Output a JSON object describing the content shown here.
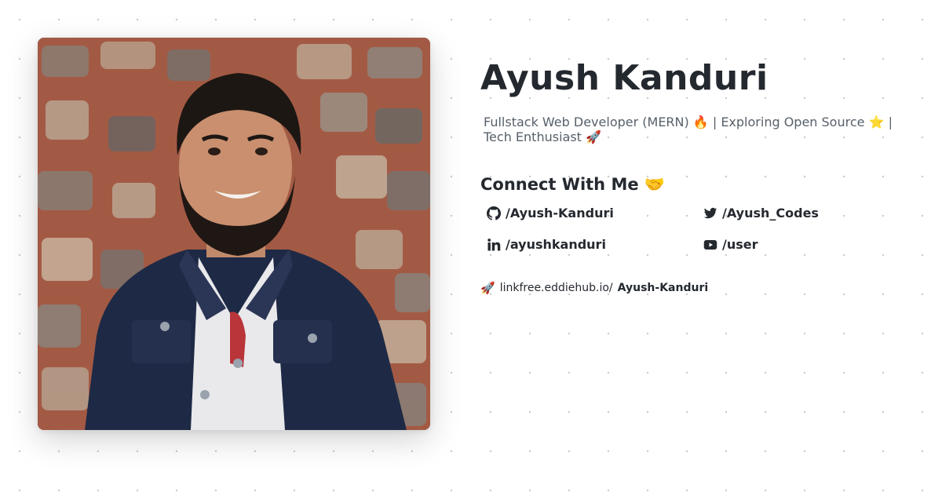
{
  "profile": {
    "name": "Ayush Kanduri",
    "tagline": "Fullstack Web Developer (MERN) 🔥 | Exploring Open Source ⭐ | Tech Enthusiast 🚀",
    "photo_alt": "profile photo"
  },
  "connect": {
    "heading": "Connect With Me 🤝",
    "links": [
      {
        "icon": "github-icon",
        "label": "/Ayush-Kanduri"
      },
      {
        "icon": "twitter-icon",
        "label": "/Ayush_Codes"
      },
      {
        "icon": "linkedin-icon",
        "label": "/ayushkanduri"
      },
      {
        "icon": "youtube-icon",
        "label": "/user"
      }
    ]
  },
  "linkfree": {
    "icon": "rocket-icon",
    "prefix": "linkfree.eddiehub.io/",
    "handle": "Ayush-Kanduri"
  },
  "colors": {
    "text": "#24292f",
    "muted": "#57606a",
    "dots": "#c9c9c9"
  }
}
